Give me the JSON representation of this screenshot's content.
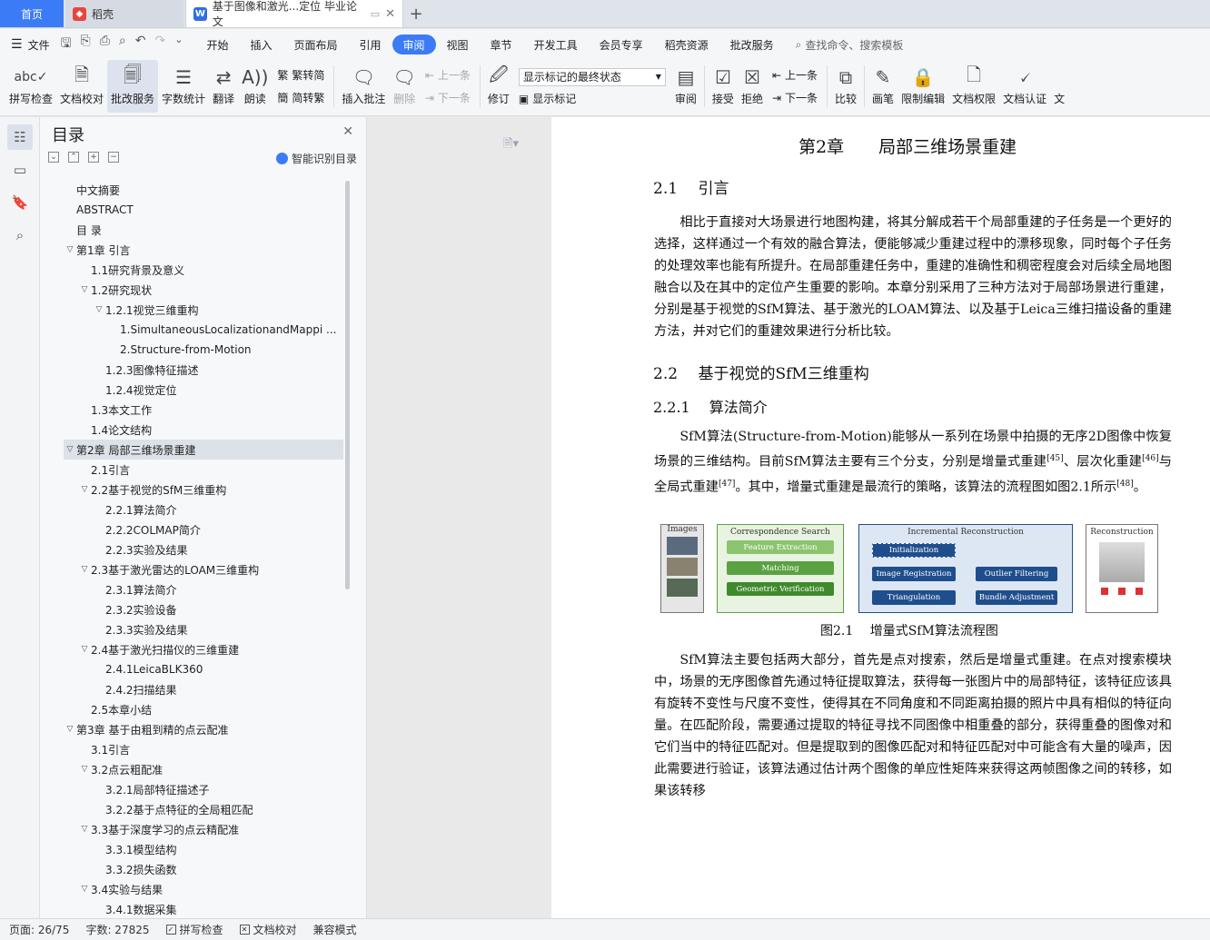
{
  "tabs": {
    "home": "首页",
    "daoke": "稻壳",
    "doc": "基于图像和激光...定位 毕业论文",
    "add": "+"
  },
  "menu": {
    "file": "文件",
    "items": [
      "开始",
      "插入",
      "页面布局",
      "引用",
      "审阅",
      "视图",
      "章节",
      "开发工具",
      "会员专享",
      "稻壳资源",
      "批改服务"
    ],
    "active_index": 4,
    "search": "查找命令、搜索模板"
  },
  "ribbon": {
    "spell": "拼写检查",
    "proof": "文档校对",
    "review_service": "批改服务",
    "word_count": "字数统计",
    "translate": "翻译",
    "read": "朗读",
    "trad": "繁转简",
    "simp": "简转繁",
    "insert_comment": "插入批注",
    "delete": "删除",
    "prev": "上一条",
    "next": "下一条",
    "track": "修订",
    "markup_select": "显示标记的最终状态",
    "show_markup": "显示标记",
    "review": "审阅",
    "accept": "接受",
    "reject": "拒绝",
    "prev2": "上一条",
    "next2": "下一条",
    "compare": "比较",
    "pen": "画笔",
    "restrict": "限制编辑",
    "rights": "文档权限",
    "certify": "文档认证",
    "more": "文"
  },
  "toc": {
    "title": "目录",
    "smart": "智能识别目录",
    "items": [
      {
        "label": "中文摘要",
        "level": 1,
        "arrow": ""
      },
      {
        "label": "ABSTRACT",
        "level": 1,
        "arrow": ""
      },
      {
        "label": "目 录",
        "level": 1,
        "arrow": ""
      },
      {
        "label": "第1章 引言",
        "level": 1,
        "arrow": "v"
      },
      {
        "label": "1.1研究背景及意义",
        "level": 2,
        "arrow": ""
      },
      {
        "label": "1.2研究现状",
        "level": 2,
        "arrow": "v"
      },
      {
        "label": "1.2.1视觉三维重构",
        "level": 3,
        "arrow": "v"
      },
      {
        "label": "1.SimultaneousLocalizationandMappi ...",
        "level": 4,
        "arrow": ""
      },
      {
        "label": "2.Structure-from-Motion",
        "level": 4,
        "arrow": ""
      },
      {
        "label": "1.2.3图像特征描述",
        "level": 3,
        "arrow": ""
      },
      {
        "label": "1.2.4视觉定位",
        "level": 3,
        "arrow": ""
      },
      {
        "label": "1.3本文工作",
        "level": 2,
        "arrow": ""
      },
      {
        "label": "1.4论文结构",
        "level": 2,
        "arrow": ""
      },
      {
        "label": "第2章 局部三维场景重建",
        "level": 1,
        "arrow": "v",
        "selected": true
      },
      {
        "label": "2.1引言",
        "level": 2,
        "arrow": ""
      },
      {
        "label": "2.2基于视觉的SfM三维重构",
        "level": 2,
        "arrow": "v"
      },
      {
        "label": "2.2.1算法简介",
        "level": 3,
        "arrow": ""
      },
      {
        "label": "2.2.2COLMAP简介",
        "level": 3,
        "arrow": ""
      },
      {
        "label": "2.2.3实验及结果",
        "level": 3,
        "arrow": ""
      },
      {
        "label": "2.3基于激光雷达的LOAM三维重构",
        "level": 2,
        "arrow": "v"
      },
      {
        "label": "2.3.1算法简介",
        "level": 3,
        "arrow": ""
      },
      {
        "label": "2.3.2实验设备",
        "level": 3,
        "arrow": ""
      },
      {
        "label": "2.3.3实验及结果",
        "level": 3,
        "arrow": ""
      },
      {
        "label": "2.4基于激光扫描仪的三维重建",
        "level": 2,
        "arrow": "v"
      },
      {
        "label": "2.4.1LeicaBLK360",
        "level": 3,
        "arrow": ""
      },
      {
        "label": "2.4.2扫描结果",
        "level": 3,
        "arrow": ""
      },
      {
        "label": "2.5本章小结",
        "level": 2,
        "arrow": ""
      },
      {
        "label": "第3章 基于由粗到精的点云配准",
        "level": 1,
        "arrow": "v"
      },
      {
        "label": "3.1引言",
        "level": 2,
        "arrow": ""
      },
      {
        "label": "3.2点云粗配准",
        "level": 2,
        "arrow": "v"
      },
      {
        "label": "3.2.1局部特征描述子",
        "level": 3,
        "arrow": ""
      },
      {
        "label": "3.2.2基于点特征的全局粗匹配",
        "level": 3,
        "arrow": ""
      },
      {
        "label": "3.3基于深度学习的点云精配准",
        "level": 2,
        "arrow": "v"
      },
      {
        "label": "3.3.1模型结构",
        "level": 3,
        "arrow": ""
      },
      {
        "label": "3.3.2损失函数",
        "level": 3,
        "arrow": ""
      },
      {
        "label": "3.4实验与结果",
        "level": 2,
        "arrow": "v"
      },
      {
        "label": "3.4.1数据采集",
        "level": 3,
        "arrow": ""
      }
    ]
  },
  "doc": {
    "chapter": "第2章　　局部三维场景重建",
    "s21": "2.1　 引言",
    "p1": "相比于直接对大场景进行地图构建，将其分解成若干个局部重建的子任务是一个更好的选择，这样通过一个有效的融合算法，便能够减少重建过程中的漂移现象，同时每个子任务的处理效率也能有所提升。在局部重建任务中，重建的准确性和稠密程度会对后续全局地图融合以及在其中的定位产生重要的影响。本章分别采用了三种方法对于局部场景进行重建，分别是基于视觉的SfM算法、基于激光的LOAM算法、以及基于Leica三维扫描设备的重建方法，并对它们的重建效果进行分析比较。",
    "s22": "2.2　 基于视觉的SfM三维重构",
    "s221": "2.2.1　 算法简介",
    "p2a": "SfM算法(Structure-from-Motion)能够从一系列在场景中拍摄的无序2D图像中恢复场景的三维结构。目前SfM算法主要有三个分支，分别是增量式重建",
    "ref45": "[45]",
    "p2b": "、层次化重建",
    "ref46": "[46]",
    "p2c": "与全局式重建",
    "ref47": "[47]",
    "p2d": "。其中，增量式重建是最流行的策略，该算法的流程图如图2.1所示",
    "ref48": "[48]",
    "p2e": "。",
    "fig": {
      "images": "Images",
      "corr": "Correspondence Search",
      "feat": "Feature Extraction",
      "match": "Matching",
      "geo": "Geometric Verification",
      "inc": "Incremental Reconstruction",
      "init": "Initialization",
      "imreg": "Image Registration",
      "outlier": "Outlier Filtering",
      "tri": "Triangulation",
      "ba": "Bundle Adjustment",
      "recon": "Reconstruction"
    },
    "fig_caption": "图2.1　 增量式SfM算法流程图",
    "p3": "SfM算法主要包括两大部分，首先是点对搜索，然后是增量式重建。在点对搜索模块中，场景的无序图像首先通过特征提取算法，获得每一张图片中的局部特征，该特征应该具有旋转不变性与尺度不变性，使得其在不同角度和不同距离拍摄的照片中具有相似的特征向量。在匹配阶段，需要通过提取的特征寻找不同图像中相重叠的部分，获得重叠的图像对和它们当中的特征匹配对。但是提取到的图像匹配对和特征匹配对中可能含有大量的噪声，因此需要进行验证，该算法通过估计两个图像的单应性矩阵来获得这两帧图像之间的转移，如果该转移"
  },
  "status": {
    "page": "页面: 26/75",
    "words": "字数: 27825",
    "spell": "拼写检查",
    "proof": "文档校对",
    "compat": "兼容模式"
  },
  "colors": {
    "accent": "#3b7bf6",
    "figure_green": "#5aa142",
    "figure_blue": "#1f4e8c"
  }
}
